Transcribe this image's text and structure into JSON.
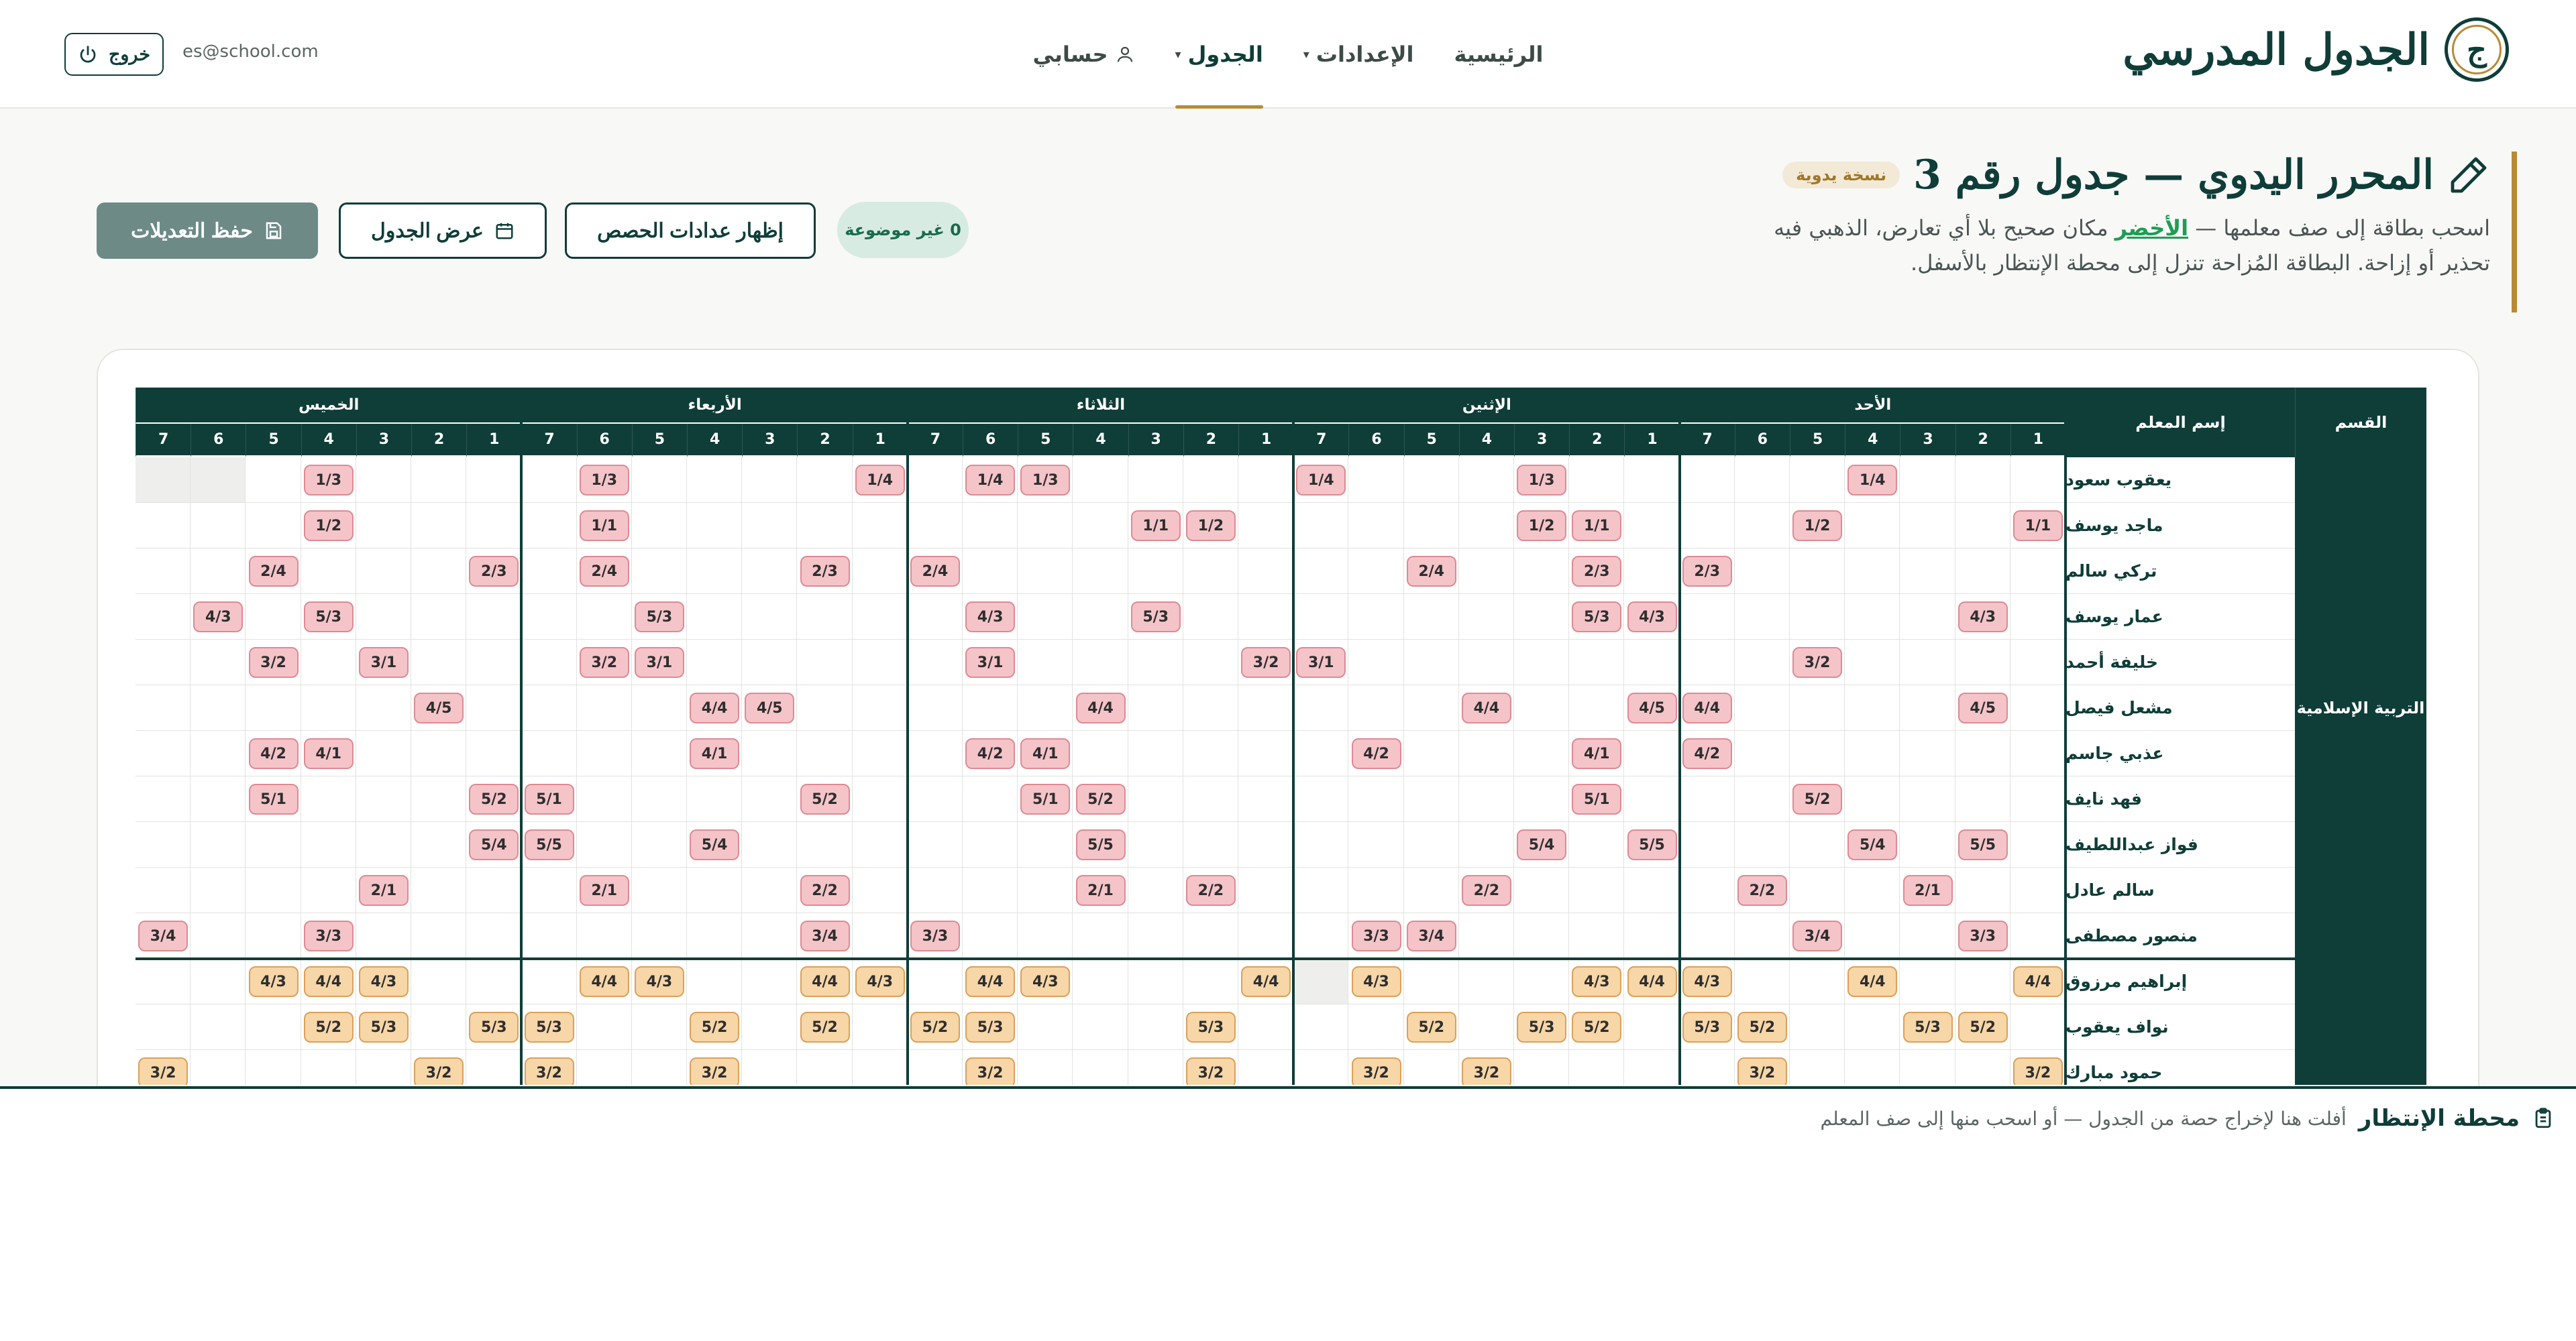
{
  "header": {
    "brand_logo_letter": "ج",
    "brand_title": "الجدول المدرسي",
    "nav": [
      {
        "label": "الرئيسية",
        "has_caret": false
      },
      {
        "label": "الإعدادات",
        "has_caret": true
      },
      {
        "label": "الجدول",
        "has_caret": true,
        "active": true
      },
      {
        "label": "حسابي",
        "has_caret": false
      }
    ],
    "user_email": "es@school.com",
    "logout_label": "خروج"
  },
  "page": {
    "title": "المحرر اليدوي — جدول رقم 3",
    "badge": "نسخة يدوية",
    "desc_part1": "اسحب بطاقة إلى صف معلمها — ",
    "desc_green": "الأخضر",
    "desc_part2": " مكان صحيح بلا أي تعارض، الذهبي فيه تحذير أو إزاحة. البطاقة المُزاحة تنزل إلى محطة الإنتظار بالأسفل.",
    "unplaced_badge": "0 غير موضوعة",
    "btn_show_counts": "إظهار عدادات الحصص",
    "btn_view_table": "عرض الجدول",
    "btn_save": "حفظ التعديلات"
  },
  "grid": {
    "col_department": "القسم",
    "col_teacher": "إسم المعلم",
    "days": [
      "الأحد",
      "الإثنين",
      "الثلاثاء",
      "الأربعاء",
      "الخميس"
    ],
    "periods": [
      "1",
      "2",
      "3",
      "4",
      "5",
      "6",
      "7"
    ],
    "departments": [
      {
        "name": "التربية الإسلامية",
        "rows": 11
      }
    ],
    "teachers": [
      {
        "name": "يعقوب سعود",
        "group": "pink",
        "slots": {
          "0-3": "1/4",
          "1-2": "1/3",
          "1-6": "1/4",
          "2-4": "1/3",
          "2-5": "1/4",
          "3-0": "1/4",
          "3-5": "1/3",
          "4-3": "1/3"
        },
        "blocked": [
          "4-5",
          "4-6"
        ]
      },
      {
        "name": "ماجد يوسف",
        "group": "pink",
        "slots": {
          "0-0": "1/1",
          "0-4": "1/2",
          "1-1": "1/1",
          "1-2": "1/2",
          "2-1": "1/2",
          "2-2": "1/1",
          "3-5": "1/1",
          "4-3": "1/2"
        }
      },
      {
        "name": "تركي سالم",
        "group": "pink",
        "slots": {
          "0-6": "2/3",
          "1-1": "2/3",
          "1-4": "2/4",
          "2-6": "2/4",
          "3-1": "2/3",
          "3-5": "2/4",
          "4-0": "2/3",
          "4-4": "2/4"
        }
      },
      {
        "name": "عمار يوسف",
        "group": "pink",
        "slots": {
          "0-1": "4/3",
          "1-0": "4/3",
          "1-1": "5/3",
          "2-2": "5/3",
          "2-5": "4/3",
          "3-4": "5/3",
          "4-3": "5/3",
          "4-5": "4/3"
        }
      },
      {
        "name": "خليفة أحمد",
        "group": "pink",
        "slots": {
          "0-4": "3/2",
          "1-6": "3/1",
          "2-0": "3/2",
          "2-5": "3/1",
          "3-4": "3/1",
          "3-5": "3/2",
          "4-2": "3/1",
          "4-4": "3/2"
        }
      },
      {
        "name": "مشعل فيصل",
        "group": "pink",
        "slots": {
          "0-1": "4/5",
          "0-6": "4/4",
          "1-0": "4/5",
          "1-3": "4/4",
          "2-3": "4/4",
          "3-2": "4/5",
          "3-3": "4/4",
          "4-1": "4/5"
        }
      },
      {
        "name": "عذبي جاسم",
        "group": "pink",
        "slots": {
          "0-6": "4/2",
          "1-1": "4/1",
          "1-5": "4/2",
          "2-4": "4/1",
          "2-5": "4/2",
          "3-3": "4/1",
          "4-3": "4/1",
          "4-4": "4/2"
        }
      },
      {
        "name": "فهد نايف",
        "group": "pink",
        "slots": {
          "0-4": "5/2",
          "1-1": "5/1",
          "2-3": "5/2",
          "2-4": "5/1",
          "3-1": "5/2",
          "3-6": "5/1",
          "4-0": "5/2",
          "4-4": "5/1"
        }
      },
      {
        "name": "فواز عبداللطيف",
        "group": "pink",
        "slots": {
          "0-1": "5/5",
          "0-3": "5/4",
          "1-0": "5/5",
          "1-2": "5/4",
          "2-3": "5/5",
          "3-3": "5/4",
          "3-6": "5/5",
          "4-0": "5/4"
        }
      },
      {
        "name": "سالم عادل",
        "group": "pink",
        "slots": {
          "0-2": "2/1",
          "0-5": "2/2",
          "1-3": "2/2",
          "2-1": "2/2",
          "2-3": "2/1",
          "3-1": "2/2",
          "3-5": "2/1",
          "4-2": "2/1"
        }
      },
      {
        "name": "منصور مصطفى",
        "group": "pink",
        "slots": {
          "0-1": "3/3",
          "0-4": "3/4",
          "1-4": "3/4",
          "1-5": "3/3",
          "2-6": "3/3",
          "3-1": "3/4",
          "4-3": "3/3",
          "4-6": "3/4"
        }
      },
      {
        "name": "إبراهيم مرزوق",
        "group": "amber",
        "slots": {
          "0-0": "4/4",
          "0-3": "4/4",
          "0-6": "4/3",
          "1-0": "4/4",
          "1-1": "4/3",
          "1-5": "4/3",
          "2-0": "4/4",
          "2-4": "4/3",
          "2-5": "4/4",
          "3-0": "4/3",
          "3-1": "4/4",
          "3-4": "4/3",
          "3-5": "4/4",
          "4-2": "4/3",
          "4-3": "4/4",
          "4-4": "4/3"
        },
        "blocked": [
          "1-6"
        ]
      },
      {
        "name": "نواف يعقوب",
        "group": "amber",
        "slots": {
          "0-1": "5/2",
          "0-2": "5/3",
          "0-5": "5/2",
          "0-6": "5/3",
          "1-1": "5/2",
          "1-2": "5/3",
          "1-4": "5/2",
          "2-1": "5/3",
          "2-5": "5/3",
          "2-6": "5/2",
          "3-1": "5/2",
          "3-3": "5/2",
          "3-6": "5/3",
          "4-0": "5/3",
          "4-2": "5/3",
          "4-3": "5/2"
        }
      },
      {
        "name": "حمود مبارك",
        "group": "amber",
        "slots": {
          "0-0": "3/2",
          "0-5": "3/2",
          "1-3": "3/2",
          "1-5": "3/2",
          "2-1": "3/2",
          "2-5": "3/2",
          "3-3": "3/2",
          "3-6": "3/2",
          "4-1": "3/2",
          "4-6": "3/2"
        }
      }
    ]
  },
  "waiting": {
    "title": "محطة الإنتظار",
    "hint": "أفلت هنا لإخراج حصة من الجدول — أو اسحب منها إلى صف المعلم"
  },
  "colors": {
    "primary": "#0f3d38",
    "gold": "#b88a34",
    "chip_pink": "#f4c4c9",
    "chip_amber": "#f7d6a7",
    "success": "#1f9d55"
  }
}
